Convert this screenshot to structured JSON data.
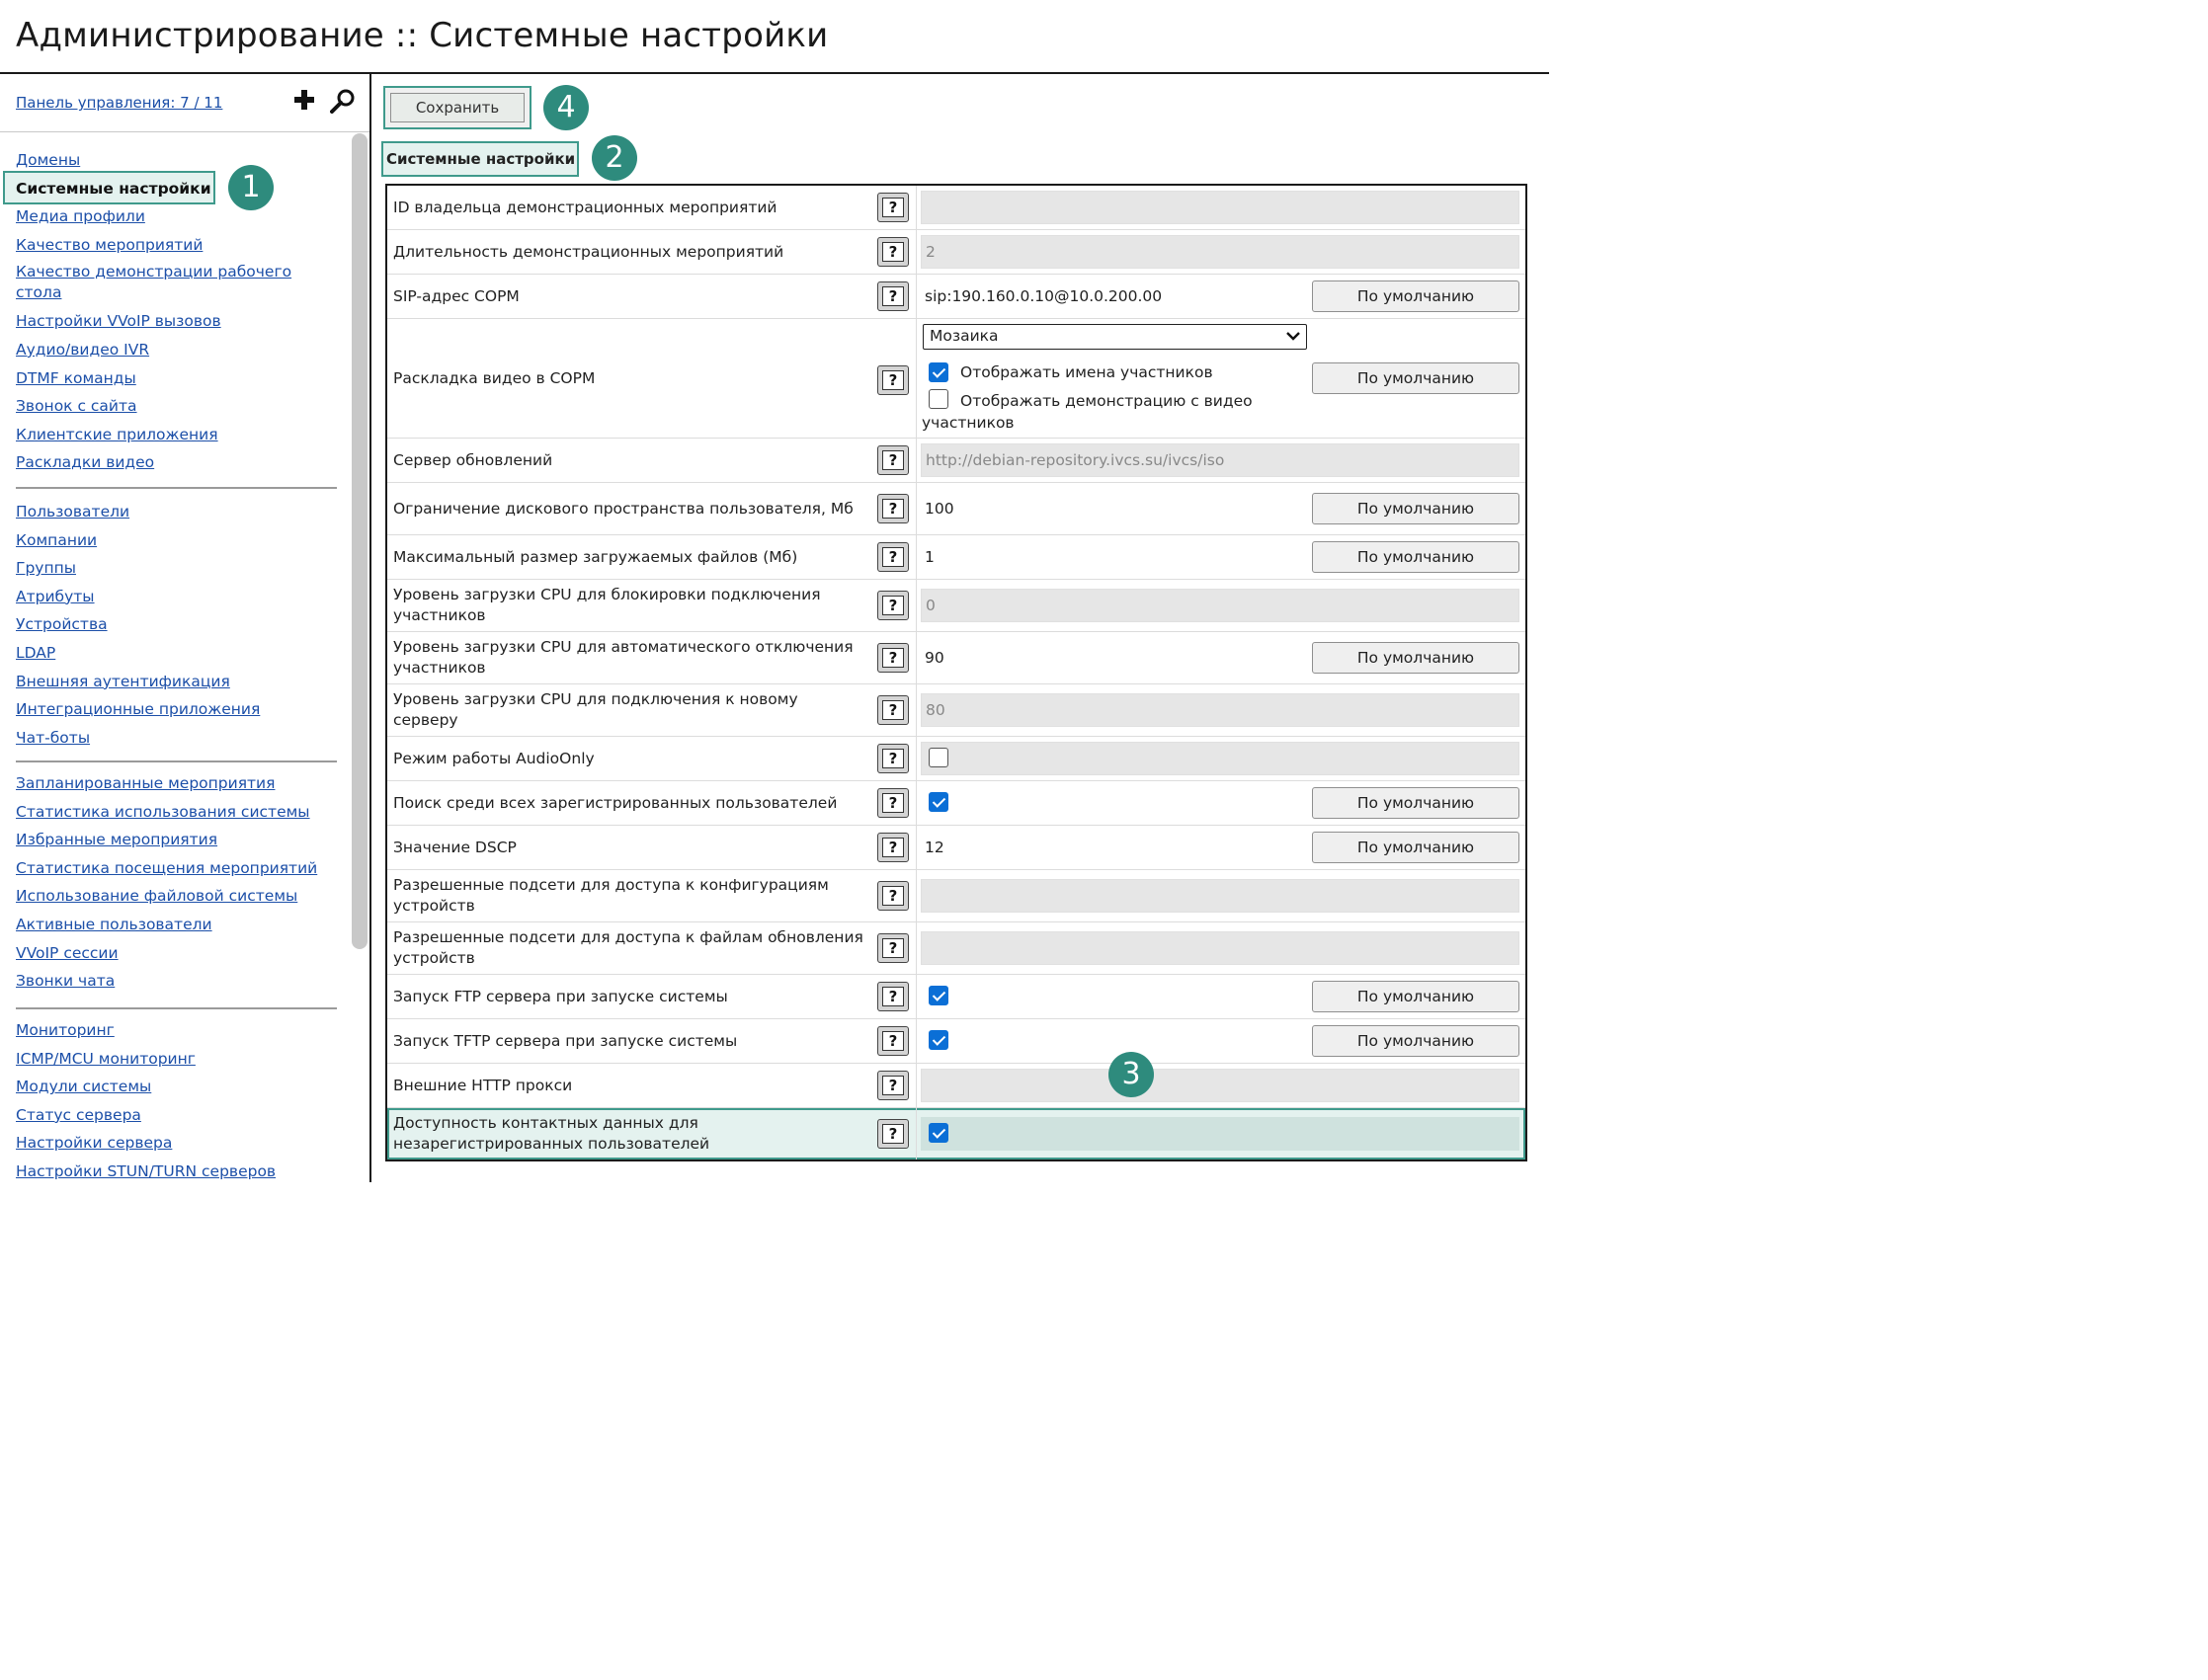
{
  "header": {
    "title": "Администрирование :: Системные настройки"
  },
  "sidebar": {
    "panel_link": "Панель управления: 7 / 11",
    "plus_icon": "plus-icon",
    "search_icon": "search-icon",
    "groups": [
      [
        "Домены",
        "Системные настройки",
        "Медиа профили",
        "Качество мероприятий",
        "Качество демонстрации рабочего стола",
        "Настройки VVoIP вызовов",
        "Аудио/видео IVR",
        "DTMF команды",
        "Звонок с сайта",
        "Клиентские приложения",
        "Раскладки видео"
      ],
      [
        "Пользователи",
        "Компании",
        "Группы",
        "Атрибуты",
        "Устройства",
        "LDAP",
        "Внешняя аутентификация",
        "Интеграционные приложения",
        "Чат-боты"
      ],
      [
        "Запланированные мероприятия",
        "Статистика использования системы",
        "Избранные мероприятия",
        "Статистика посещения мероприятий",
        "Использование файловой системы",
        "Активные пользователи",
        "VVoIP сессии",
        "Звонки чата"
      ],
      [
        "Мониторинг",
        "ICMP/MCU мониторинг",
        "Модули системы",
        "Статус сервера",
        "Настройки сервера",
        "Настройки STUN/TURN серверов"
      ]
    ],
    "active_item": "Системные настройки"
  },
  "toolbar": {
    "save_label": "Сохранить"
  },
  "section": {
    "heading": "Системные настройки"
  },
  "badges": {
    "b1": "1",
    "b2": "2",
    "b3": "3",
    "b4": "4"
  },
  "default_label": "По умолчанию",
  "help_glyph": "?",
  "settings": [
    {
      "label": "ID владельца демонстрационных мероприятий",
      "kind": "readonly",
      "value": "",
      "default_button": false
    },
    {
      "label": "Длительность демонстрационных мероприятий",
      "kind": "readonly",
      "value": "2",
      "default_button": false
    },
    {
      "label": "SIP-адрес СОРМ",
      "kind": "text",
      "value": "sip:190.160.0.10@10.0.200.00",
      "default_button": true
    },
    {
      "label": "Раскладка видео в СОРМ",
      "kind": "layout",
      "select_value": "Мозаика",
      "option1": "Отображать имена участников",
      "option1_checked": true,
      "option2": "Отображать демонстрацию с видео",
      "option2_cont": "участников",
      "option2_checked": false,
      "default_button": true
    },
    {
      "label": "Сервер обновлений",
      "kind": "readonly",
      "value": "http://debian-repository.ivcs.su/ivcs/iso",
      "default_button": false
    },
    {
      "label": "Ограничение дискового пространства пользователя, Мб",
      "kind": "text",
      "value": "100",
      "default_button": true
    },
    {
      "label": "Максимальный размер загружаемых файлов (Мб)",
      "kind": "text",
      "value": "1",
      "default_button": true
    },
    {
      "label": "Уровень загрузки CPU для блокировки подключения участников",
      "kind": "readonly",
      "value": "0",
      "default_button": false
    },
    {
      "label": "Уровень загрузки CPU для автоматического отключения участников",
      "kind": "text",
      "value": "90",
      "default_button": true
    },
    {
      "label": "Уровень загрузки CPU для подключения к новому серверу",
      "kind": "readonly",
      "value": "80",
      "default_button": false
    },
    {
      "label": "Режим работы AudioOnly",
      "kind": "checkbox",
      "checked": false,
      "default_button": false
    },
    {
      "label": "Поиск среди всех зарегистрированных пользователей",
      "kind": "checkbox",
      "checked": true,
      "default_button": true
    },
    {
      "label": "Значение DSCP",
      "kind": "text",
      "value": "12",
      "default_button": true
    },
    {
      "label": "Разрешенные подсети для доступа к конфигурациям устройств",
      "kind": "readonly",
      "value": "",
      "default_button": false
    },
    {
      "label": "Разрешенные подсети для доступа к файлам обновления устройств",
      "kind": "readonly",
      "value": "",
      "default_button": false
    },
    {
      "label": "Запуск FTP сервера при запуске системы",
      "kind": "checkbox",
      "checked": true,
      "default_button": true
    },
    {
      "label": "Запуск TFTP сервера при запуске системы",
      "kind": "checkbox",
      "checked": true,
      "default_button": true
    },
    {
      "label": "Внешние HTTP прокси",
      "kind": "readonly",
      "value": "",
      "default_button": false
    },
    {
      "label": "Доступность контактных данных для незарегистрированных пользователей",
      "kind": "checkbox",
      "checked": true,
      "default_button": false,
      "highlight": true
    }
  ],
  "colors": {
    "accent": "#2e8b7d",
    "highlight_bg": "#e4f2ef",
    "link": "#1c4fa8",
    "checkbox": "#0b6fd6"
  }
}
